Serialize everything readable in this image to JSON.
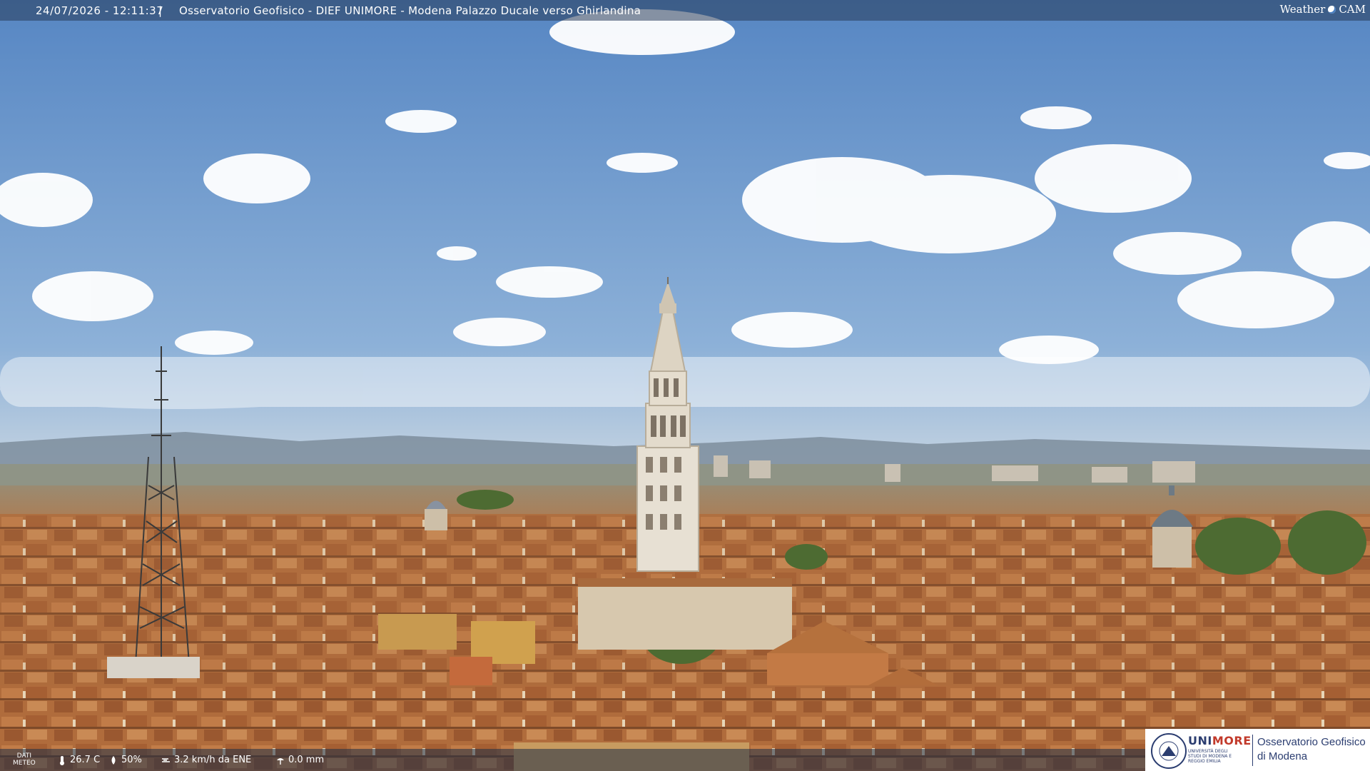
{
  "header": {
    "datetime": "24/07/2026 - 12:11:37",
    "separator": "|",
    "title": "Osservatorio Geofisico - DIEF UNIMORE - Modena Palazzo Ducale verso Ghirlandina",
    "brand_left": "Weather",
    "brand_right": "CAM"
  },
  "weather": {
    "label_line1": "DATI",
    "label_line2": "METEO",
    "temperature": "26.7 C",
    "humidity": "50%",
    "wind": "3.2 km/h da ENE",
    "rain": "0.0 mm",
    "icons": {
      "temperature": "thermometer-icon",
      "humidity": "humidity-drop-icon",
      "wind": "wind-icon",
      "rain": "rain-icon"
    }
  },
  "logo": {
    "uni_part1": "UNI",
    "uni_part2": "MORE",
    "uni_sub": "UNIVERSITÀ DEGLI STUDI DI MODENA E REGGIO EMILIA",
    "obs_line1": "Osservatorio Geofisico",
    "obs_line2": "di Modena"
  },
  "colors": {
    "sky_top": "#5f8fc9",
    "sky_bottom": "#c7d6e4",
    "roofs": "#b5713d",
    "tower": "#e9e2d6",
    "brand_blue": "#2b3d70",
    "brand_red": "#c23a2b"
  }
}
